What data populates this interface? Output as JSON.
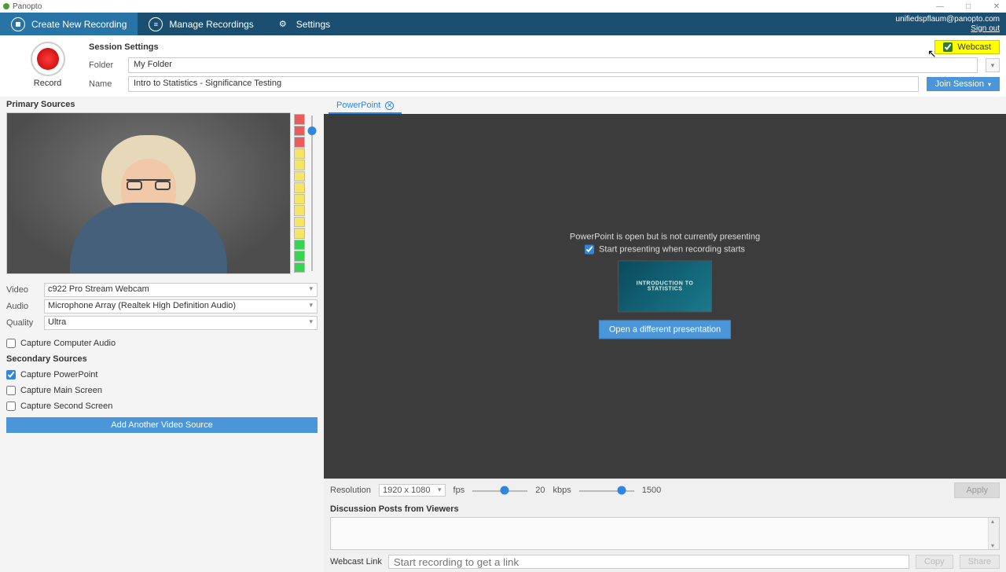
{
  "window": {
    "title": "Panopto"
  },
  "nav": {
    "create": "Create New Recording",
    "manage": "Manage Recordings",
    "settings": "Settings"
  },
  "account": {
    "email": "unifiedspflaum@panopto.com",
    "signout": "Sign out"
  },
  "session": {
    "sectionTitle": "Session Settings",
    "folderLabel": "Folder",
    "folderValue": "My Folder",
    "nameLabel": "Name",
    "nameValue": "Intro to Statistics - Significance Testing",
    "webcastLabel": "Webcast",
    "webcastChecked": true,
    "joinSession": "Join Session",
    "recordLabel": "Record"
  },
  "primary": {
    "title": "Primary Sources",
    "videoLabel": "Video",
    "videoValue": "c922 Pro Stream Webcam",
    "audioLabel": "Audio",
    "audioValue": "Microphone Array (Realtek High Definition Audio)",
    "qualityLabel": "Quality",
    "qualityValue": "Ultra",
    "captureAudio": "Capture Computer Audio",
    "captureAudioChecked": false
  },
  "secondary": {
    "title": "Secondary Sources",
    "ppt": "Capture PowerPoint",
    "pptChecked": true,
    "main": "Capture Main Screen",
    "mainChecked": false,
    "second": "Capture Second Screen",
    "secondChecked": false,
    "addSource": "Add Another Video Source"
  },
  "ppt": {
    "tab": "PowerPoint",
    "message": "PowerPoint is open but is not currently presenting",
    "startPresenting": "Start presenting when recording starts",
    "startPresentingChecked": true,
    "slideTitle": "INTRODUCTION TO STATISTICS",
    "openDifferent": "Open a different presentation"
  },
  "encoder": {
    "resolutionLabel": "Resolution",
    "resolutionValue": "1920 x 1080",
    "fpsLabel": "fps",
    "fpsValue": "20",
    "kbpsLabel": "kbps",
    "kbpsValue": "1500",
    "apply": "Apply"
  },
  "discussion": {
    "title": "Discussion Posts from Viewers"
  },
  "webcastLink": {
    "label": "Webcast Link",
    "placeholder": "Start recording to get a link",
    "copy": "Copy",
    "share": "Share"
  }
}
